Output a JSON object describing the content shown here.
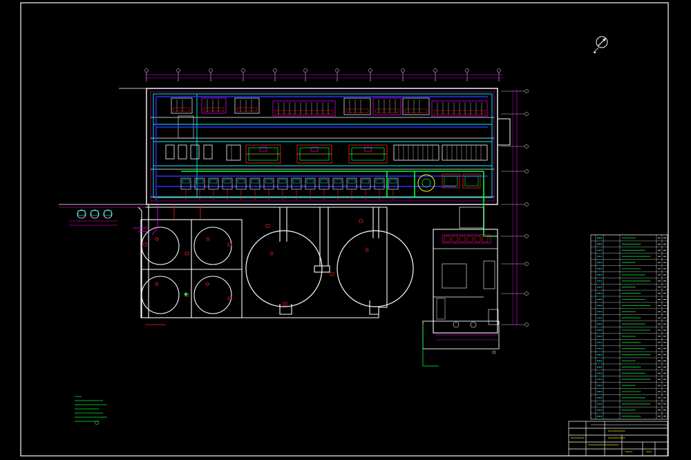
{
  "colors": {
    "background": "#000000",
    "frame": "#ffffff",
    "wall": "#ffffff",
    "pipe_cyan": "#00ffff",
    "pipe_green": "#00ff3c",
    "pipe_magenta": "#ff00ff",
    "pipe_red": "#ff2020",
    "pipe_blue": "#3030ff",
    "pipe_yellow": "#ffff00",
    "pipe_orange": "#ff8000"
  },
  "north_arrow": {
    "icon": "north-arrow-icon"
  },
  "title_block": {
    "rows": [
      "",
      "",
      "",
      "",
      ""
    ]
  },
  "equipment_legend": {
    "row_count": 30
  }
}
